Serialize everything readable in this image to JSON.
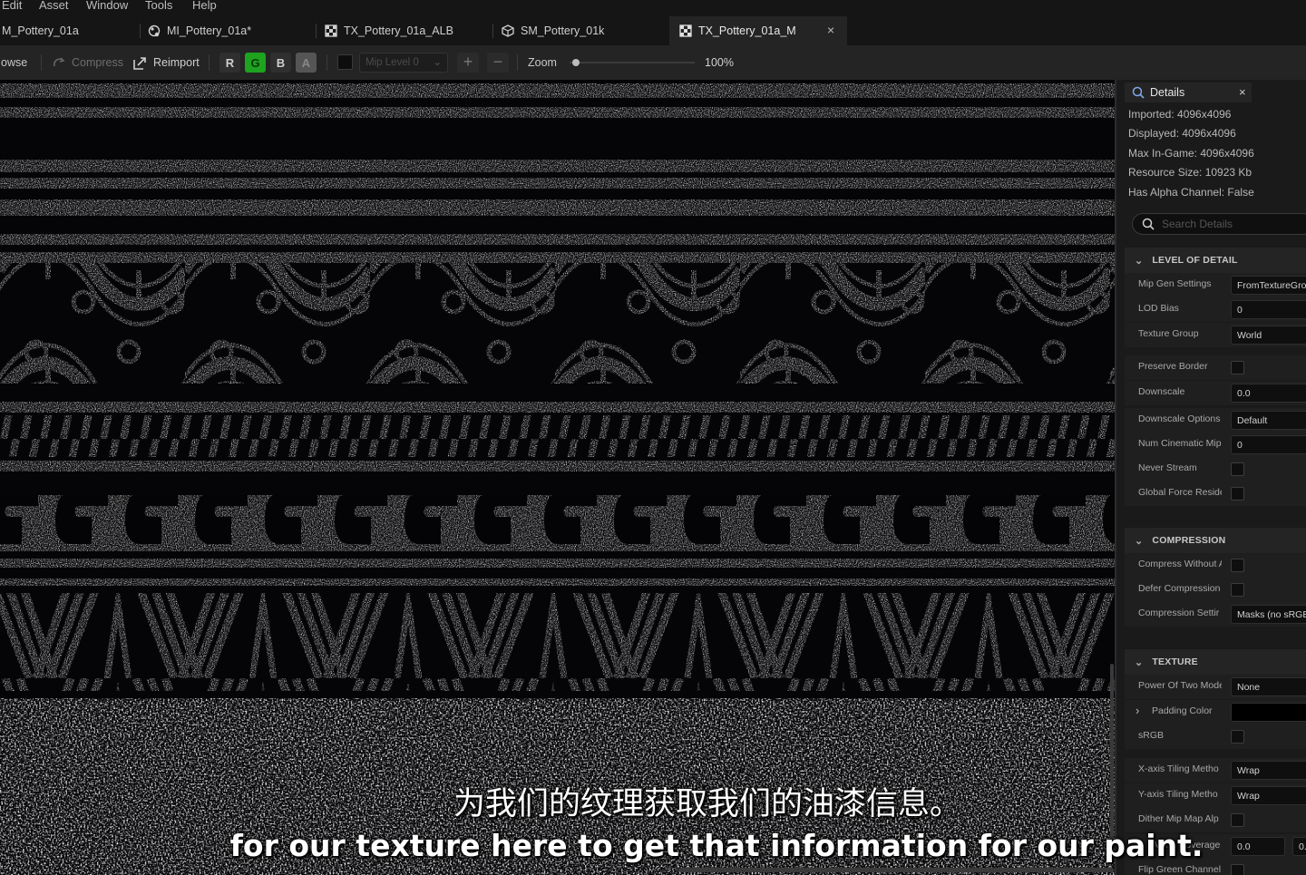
{
  "menu": [
    "Edit",
    "Asset",
    "Window",
    "Tools",
    "Help"
  ],
  "tabs": [
    {
      "label": "M_Pottery_01a",
      "icon": "material-icon"
    },
    {
      "label": "MI_Pottery_01a*",
      "icon": "material-instance-icon"
    },
    {
      "label": "TX_Pottery_01a_ALB",
      "icon": "texture-icon"
    },
    {
      "label": "SM_Pottery_01k",
      "icon": "static-mesh-icon"
    },
    {
      "label": "TX_Pottery_01a_M",
      "icon": "texture-icon",
      "active": true,
      "close": "×"
    }
  ],
  "toolbar": {
    "browse": "owse",
    "compress": "Compress",
    "reimport": "Reimport",
    "channels": {
      "r": "R",
      "g": "G",
      "b": "B",
      "a": "A"
    },
    "mip_level": "Mip Level 0",
    "zoom_label": "Zoom",
    "zoom_value": "100%",
    "zoom_level": 0.02
  },
  "details": {
    "tab_label": "Details",
    "close": "×",
    "info": [
      "Imported: 4096x4096",
      "Displayed: 4096x4096",
      "Max In-Game: 4096x4096",
      "Resource Size: 10923 Kb",
      "Has Alpha Channel: False"
    ],
    "search_placeholder": "Search Details",
    "sections": {
      "lod": {
        "title": "LEVEL OF DETAIL",
        "props": [
          {
            "label": "Mip Gen Settings",
            "value": "FromTextureGro"
          },
          {
            "label": "LOD Bias",
            "value": "0"
          },
          {
            "label": "Texture Group",
            "value": "World"
          },
          {
            "label": "Preserve Border",
            "check": true
          },
          {
            "label": "Downscale",
            "value": "0.0"
          },
          {
            "label": "Downscale Options",
            "value": "Default"
          },
          {
            "label": "Num Cinematic Mip",
            "value": "0"
          },
          {
            "label": "Never Stream",
            "check": true
          },
          {
            "label": "Global Force Reside",
            "check": true
          }
        ]
      },
      "compression": {
        "title": "COMPRESSION",
        "props": [
          {
            "label": "Compress Without A",
            "check": true
          },
          {
            "label": "Defer Compression",
            "check": true
          },
          {
            "label": "Compression Settir",
            "value": "Masks (no sRGB"
          }
        ]
      },
      "texture": {
        "title": "TEXTURE",
        "props": [
          {
            "label": "Power Of Two Mode",
            "value": "None"
          },
          {
            "label": "Padding Color",
            "value": ""
          },
          {
            "label": "sRGB",
            "check": true
          },
          {
            "label": "X-axis Tiling Metho",
            "value": "Wrap"
          },
          {
            "label": "Y-axis Tiling Metho",
            "value": "Wrap"
          },
          {
            "label": "Dither Mip Map Alp",
            "check": true
          },
          {
            "label": "Alpha Coverage",
            "value": "0.0"
          },
          {
            "label": "Flip Green Channel",
            "check": true
          }
        ]
      }
    }
  },
  "subtitles": {
    "zh": "为我们的纹理获取我们的油漆信息。",
    "en": "for our texture here to get that information for our paint."
  }
}
